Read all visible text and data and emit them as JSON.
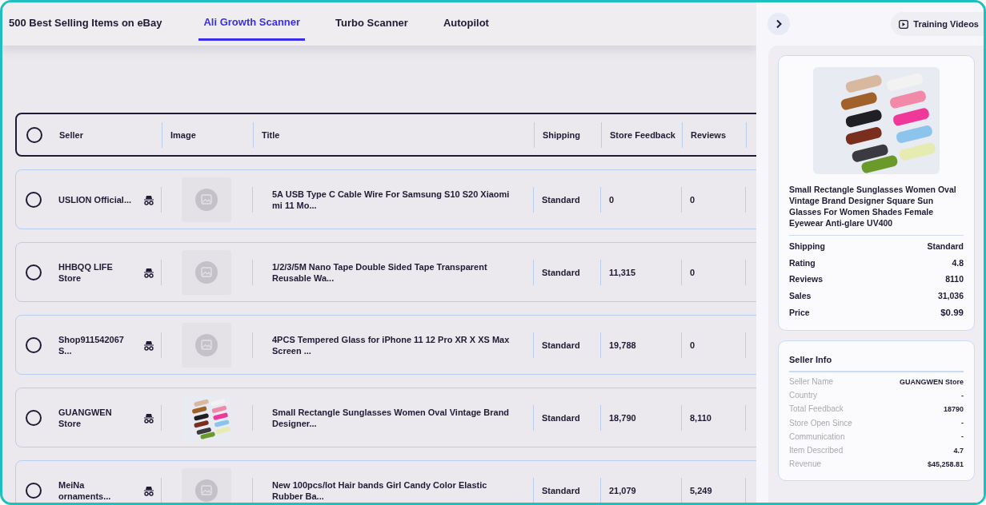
{
  "tabs": [
    {
      "label": "500 Best Selling Items on eBay",
      "selected": false
    },
    {
      "label": "Ali Growth Scanner",
      "selected": true
    },
    {
      "label": "Turbo Scanner",
      "selected": false
    },
    {
      "label": "Autopilot",
      "selected": false
    }
  ],
  "table": {
    "all_selected": false,
    "columns": [
      "Seller",
      "Image",
      "Title",
      "Shipping",
      "Store Feedback",
      "Reviews"
    ],
    "rows": [
      {
        "selected": false,
        "seller": "USLION Official...",
        "image": {
          "kind": "placeholder"
        },
        "title": "5A USB Type C Cable Wire For Samsung S10 S20 Xiaomi mi 11 Mo...",
        "shipping": "Standard",
        "store_feedback": "0",
        "reviews": "0"
      },
      {
        "selected": false,
        "seller": "HHBQQ LIFE Store",
        "image": {
          "kind": "placeholder"
        },
        "title": "1/2/3/5M Nano Tape Double Sided Tape Transparent Reusable Wa...",
        "shipping": "Standard",
        "store_feedback": "11,315",
        "reviews": "0"
      },
      {
        "selected": false,
        "seller": "Shop911542067 S...",
        "image": {
          "kind": "placeholder"
        },
        "title": "4PCS Tempered Glass for iPhone 11 12 Pro XR X XS Max Screen ...",
        "shipping": "Standard",
        "store_feedback": "19,788",
        "reviews": "0"
      },
      {
        "selected": false,
        "seller": "GUANGWEN Store",
        "title": "Small Rectangle Sunglasses Women Oval Vintage Brand Designer...",
        "shipping": "Standard",
        "store_feedback": "18,790",
        "reviews": "8,110"
      },
      {
        "selected": false,
        "seller": "MeiNa ornaments...",
        "image": {
          "kind": "placeholder"
        },
        "title": "New 100pcs/lot Hair bands Girl Candy Color Elastic Rubber Ba...",
        "shipping": "Standard",
        "store_feedback": "21,079",
        "reviews": "5,249"
      }
    ]
  },
  "side_panel": {
    "training_button": "Training Videos",
    "product": {
      "title": "Small Rectangle Sunglasses Women Oval Vintage Brand Designer Square Sun Glasses For Women Shades Female Eyewear Anti-glare UV400",
      "details": [
        {
          "label": "Shipping",
          "value": "Standard",
          "kind": "plain"
        },
        {
          "label": "Rating",
          "value": "4.8",
          "kind": "plain"
        },
        {
          "label": "Reviews",
          "value": "8110",
          "kind": "plain"
        },
        {
          "label": "Sales",
          "value": "31,036",
          "kind": "plain"
        },
        {
          "label": "Price",
          "value": "$0.99",
          "kind": "price"
        }
      ]
    },
    "seller_info": {
      "title": "Seller Info",
      "rows": [
        {
          "label": "Seller Name",
          "value": "GUANGWEN Store"
        },
        {
          "label": "Country",
          "value": "-"
        },
        {
          "label": "Total Feedback",
          "value": "18790"
        },
        {
          "label": "Store Open Since",
          "value": "-"
        },
        {
          "label": "Communication",
          "value": "-"
        },
        {
          "label": "Item Described",
          "value": "4.7"
        },
        {
          "label": "Revenue",
          "value": "$45,258.81"
        }
      ]
    }
  }
}
